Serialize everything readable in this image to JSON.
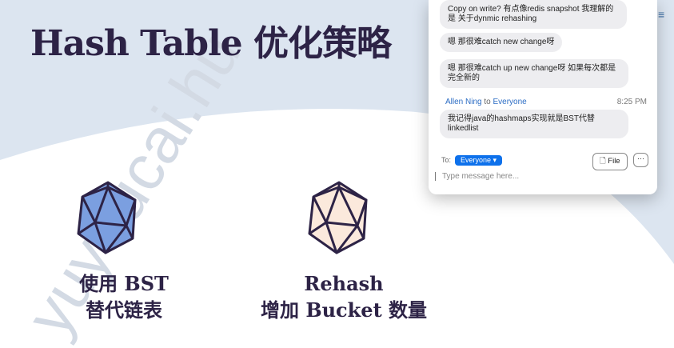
{
  "slide": {
    "title": "Hash Table 优化策略",
    "watermark": "yuyoucai.hu",
    "items": [
      {
        "line1": "使用 BST",
        "line2": "替代链表",
        "color": "#7b9fe0"
      },
      {
        "line1": "Rehash",
        "line2": "增加 Bucket 数量",
        "color": "#fbe9dc"
      }
    ]
  },
  "chat": {
    "messages": [
      {
        "text": "Copy on write?  有点像redis snapshot 我理解的是 关于dynmic rehashing"
      },
      {
        "text": "嗯 那很难catch new change呀"
      },
      {
        "text": "嗯 那很难catch up new change呀 如果每次都是完全新的"
      },
      {
        "text": "我记得java的hashmaps实现就是BST代替linkedlist"
      }
    ],
    "sender": "Allen Ning",
    "to_word": "to",
    "recipient": "Everyone",
    "time": "8:25 PM",
    "to_label": "To:",
    "to_value": "Everyone ▾",
    "file_label": "File",
    "more_label": "···",
    "placeholder": "Type message here..."
  },
  "colors": {
    "ink": "#2d2346",
    "accent": "#0e71eb"
  }
}
